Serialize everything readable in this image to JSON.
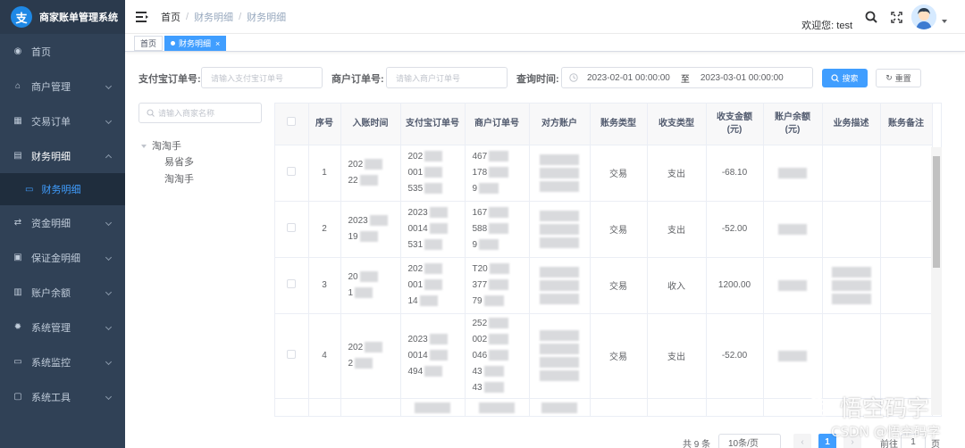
{
  "app": {
    "title": "商家账单管理系统",
    "logo_char": "支"
  },
  "sidebar": {
    "items": [
      {
        "label": "首页",
        "icon": "dashboard-icon",
        "glyph": "◉",
        "arrow": false
      },
      {
        "label": "商户管理",
        "icon": "merchant-icon",
        "glyph": "⌂",
        "arrow": true
      },
      {
        "label": "交易订单",
        "icon": "table-icon",
        "glyph": "▦",
        "arrow": true
      },
      {
        "label": "财务明细",
        "icon": "document-icon",
        "glyph": "▤",
        "arrow": true,
        "open": true
      },
      {
        "label": "资金明细",
        "icon": "fund-icon",
        "glyph": "⇄",
        "arrow": true
      },
      {
        "label": "保证金明细",
        "icon": "deposit-icon",
        "glyph": "▣",
        "arrow": true
      },
      {
        "label": "账户余额",
        "icon": "balance-icon",
        "glyph": "▥",
        "arrow": true
      },
      {
        "label": "系统管理",
        "icon": "settings-icon",
        "glyph": "✹",
        "arrow": true
      },
      {
        "label": "系统监控",
        "icon": "monitor-icon",
        "glyph": "▭",
        "arrow": true
      },
      {
        "label": "系统工具",
        "icon": "toolbox-icon",
        "glyph": "▢",
        "arrow": true
      }
    ],
    "active_sub": {
      "label": "财务明细",
      "icon": "list-icon",
      "glyph": "▭"
    }
  },
  "navbar": {
    "breadcrumb": [
      "首页",
      "财务明细",
      "财务明细"
    ],
    "welcome": "欢迎您: test",
    "icons": [
      "search-icon",
      "fullscreen-icon"
    ]
  },
  "tags": [
    {
      "label": "首页",
      "active": false
    },
    {
      "label": "财务明细",
      "active": true,
      "close": "×"
    }
  ],
  "search": {
    "alipay_label": "支付宝订单号:",
    "alipay_placeholder": "请输入支付宝订单号",
    "merchant_label": "商户订单号:",
    "merchant_placeholder": "请输入商户订单号",
    "time_label": "查询时间:",
    "start": "2023-02-01 00:00:00",
    "sep": "至",
    "end": "2023-03-01 00:00:00",
    "search_btn": "搜索",
    "reset_btn": "重置"
  },
  "tree": {
    "placeholder": "请输入商家名称",
    "root": "淘淘手",
    "children": [
      "易省多",
      "淘淘手"
    ]
  },
  "table": {
    "headers": [
      "",
      "序号",
      "入账时间",
      "支付宝订单号",
      "商户订单号",
      "对方账户",
      "账务类型",
      "收支类型",
      "收支金额(元)",
      "账户余额(元)",
      "业务描述",
      "账务备注"
    ],
    "rows": [
      {
        "no": "1",
        "time": [
          "202",
          "22"
        ],
        "alipay": [
          "202",
          "001",
          "535"
        ],
        "merchant": [
          "467",
          "178",
          "9"
        ],
        "type": "交易",
        "io": "支出",
        "amount": "-68.10"
      },
      {
        "no": "2",
        "time": [
          "2023",
          "19"
        ],
        "alipay": [
          "2023",
          "0014",
          "531"
        ],
        "merchant": [
          "167",
          "588",
          "9"
        ],
        "type": "交易",
        "io": "支出",
        "amount": "-52.00"
      },
      {
        "no": "3",
        "time": [
          "20",
          "1"
        ],
        "alipay": [
          "202",
          "001",
          "14"
        ],
        "merchant": [
          "T20",
          "377",
          "79"
        ],
        "type": "交易",
        "io": "收入",
        "amount": "1200.00"
      },
      {
        "no": "4",
        "time": [
          "202",
          "2"
        ],
        "alipay": [
          "2023",
          "0014",
          "494"
        ],
        "merchant": [
          "252",
          "002",
          "046",
          "43",
          "43"
        ],
        "type": "交易",
        "io": "支出",
        "amount": "-52.00"
      }
    ]
  },
  "pagination": {
    "total": "共 9 条",
    "page_size": "10条/页",
    "current": "1",
    "goto_label": "前往",
    "goto_value": "1",
    "page_unit": "页"
  },
  "watermark": {
    "wechat": "悟空码字",
    "csdn": "CSDN @悟空码字"
  },
  "colors": {
    "sidebar": "#304156",
    "primary": "#409eff",
    "submenu": "#1f2d3d"
  }
}
